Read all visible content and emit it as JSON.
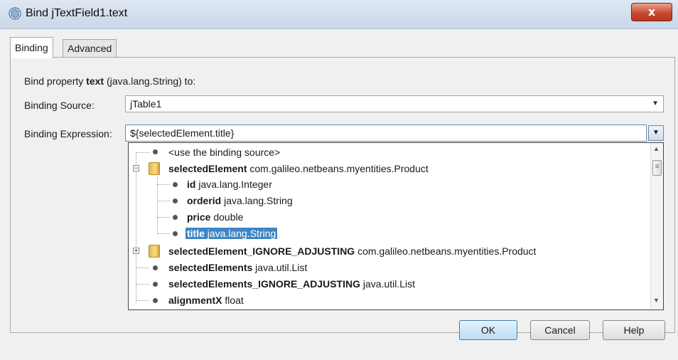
{
  "window": {
    "title": "Bind jTextField1.text",
    "close_label": "x"
  },
  "tabs": [
    {
      "label": "Binding",
      "active": true
    },
    {
      "label": "Advanced",
      "active": false
    }
  ],
  "prompt": {
    "prefix": "Bind property ",
    "property": "text",
    "suffix": " (java.lang.String) to:"
  },
  "binding_source": {
    "label": "Binding Source:",
    "value": "jTable1"
  },
  "binding_expression": {
    "label": "Binding Expression:",
    "value": "${selectedElement.title}"
  },
  "tree": {
    "use_source": "<use the binding source>",
    "items": [
      {
        "name": "selectedElement",
        "type": " com.galileo.netbeans.myentities.Product",
        "expanded": true
      },
      {
        "name": "id",
        "type": " java.lang.Integer"
      },
      {
        "name": "orderid",
        "type": " java.lang.String"
      },
      {
        "name": "price",
        "type": " double"
      },
      {
        "name": "title",
        "type": " java.lang.String",
        "selected": true
      },
      {
        "name": "selectedElement_IGNORE_ADJUSTING",
        "type": " com.galileo.netbeans.myentities.Product",
        "expanded": false
      },
      {
        "name": "selectedElements",
        "type": " java.util.List"
      },
      {
        "name": "selectedElements_IGNORE_ADJUSTING",
        "type": " java.util.List"
      },
      {
        "name": "alignmentX",
        "type": " float"
      }
    ]
  },
  "buttons": {
    "ok": "OK",
    "cancel": "Cancel",
    "help": "Help"
  },
  "colors": {
    "selection": "#3d85c6",
    "close": "#c4462b"
  }
}
